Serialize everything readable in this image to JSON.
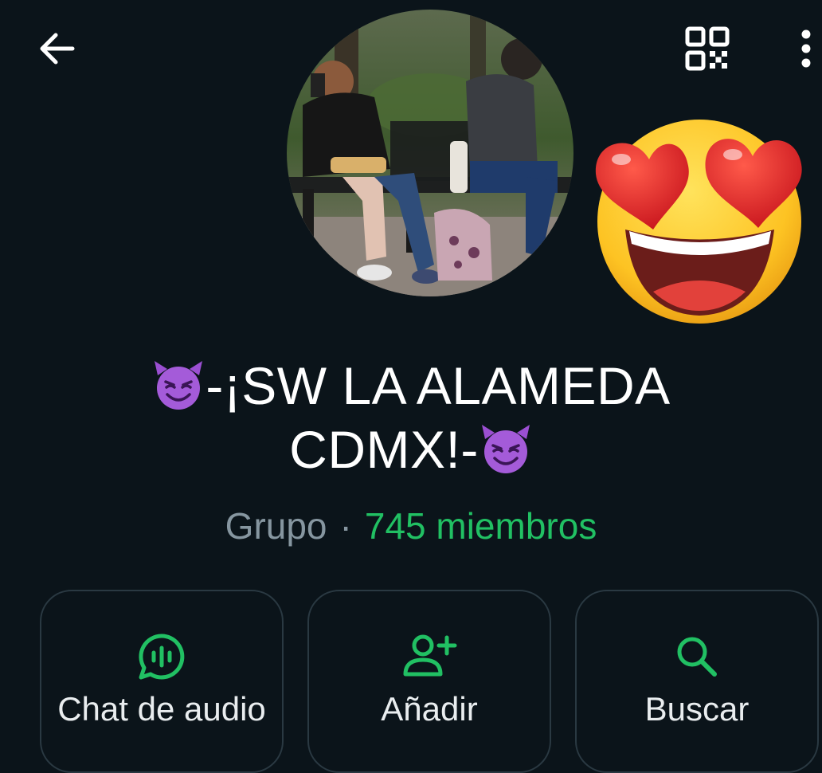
{
  "header": {
    "back_icon": "arrow-left-icon",
    "qr_icon": "qr-code-icon",
    "more_icon": "more-vertical-icon"
  },
  "group": {
    "avatar": "group-photo",
    "sticker": "heart-eyes-emoji",
    "name_prefix_emoji": "smiling-devil-emoji",
    "name_line1": "-¡SW LA ALAMEDA",
    "name_line2": "CDMX!-",
    "name_suffix_emoji": "smiling-devil-emoji",
    "type": "Grupo",
    "separator": "·",
    "members": "745 miembros"
  },
  "actions": [
    {
      "label": "Chat de audio",
      "icon": "audio-chat-icon"
    },
    {
      "label": "Añadir",
      "icon": "add-person-icon"
    },
    {
      "label": "Buscar",
      "icon": "search-icon"
    }
  ],
  "colors": {
    "background": "#0b141a",
    "accent": "#21c063",
    "secondary_text": "#8696a0",
    "card_border": "#2a3942"
  }
}
